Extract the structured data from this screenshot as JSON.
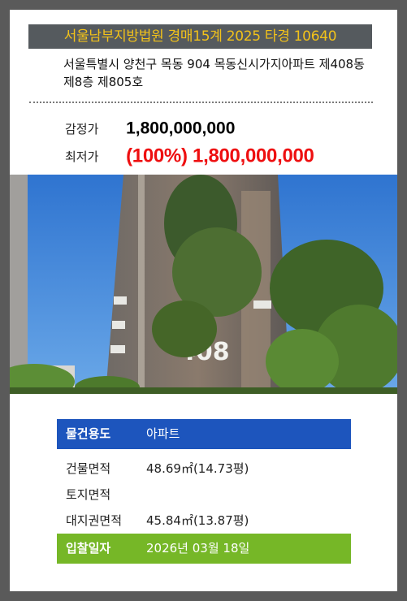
{
  "header": {
    "title": "서울남부지방법원 경매15계 2025 타경 10640",
    "address": "서울특별시 양천구 목동 904 목동신시가지아파트 제408동 제8층 제805호"
  },
  "prices": {
    "appraisal_label": "감정가",
    "appraisal_value": "1,800,000,000",
    "minimum_label": "최저가",
    "minimum_value": "(100%) 1,800,000,000"
  },
  "photo": {
    "building_number_text": "408"
  },
  "details": {
    "property_type_label": "물건용도",
    "property_type_value": "아파트",
    "building_area_label": "건물면적",
    "building_area_value": "48.69㎡(14.73평)",
    "land_area_label": "토지면적",
    "land_area_value": "",
    "land_right_area_label": "대지권면적",
    "land_right_area_value": "45.84㎡(13.87평)",
    "bid_date_label": "입찰일자",
    "bid_date_value": "2026년 03월 18일"
  },
  "colors": {
    "title_bg": "#555a5e",
    "title_text": "#f2c21a",
    "minimum_price": "#ee0f10",
    "type_row": "#1d55bd",
    "date_row": "#76b727"
  }
}
